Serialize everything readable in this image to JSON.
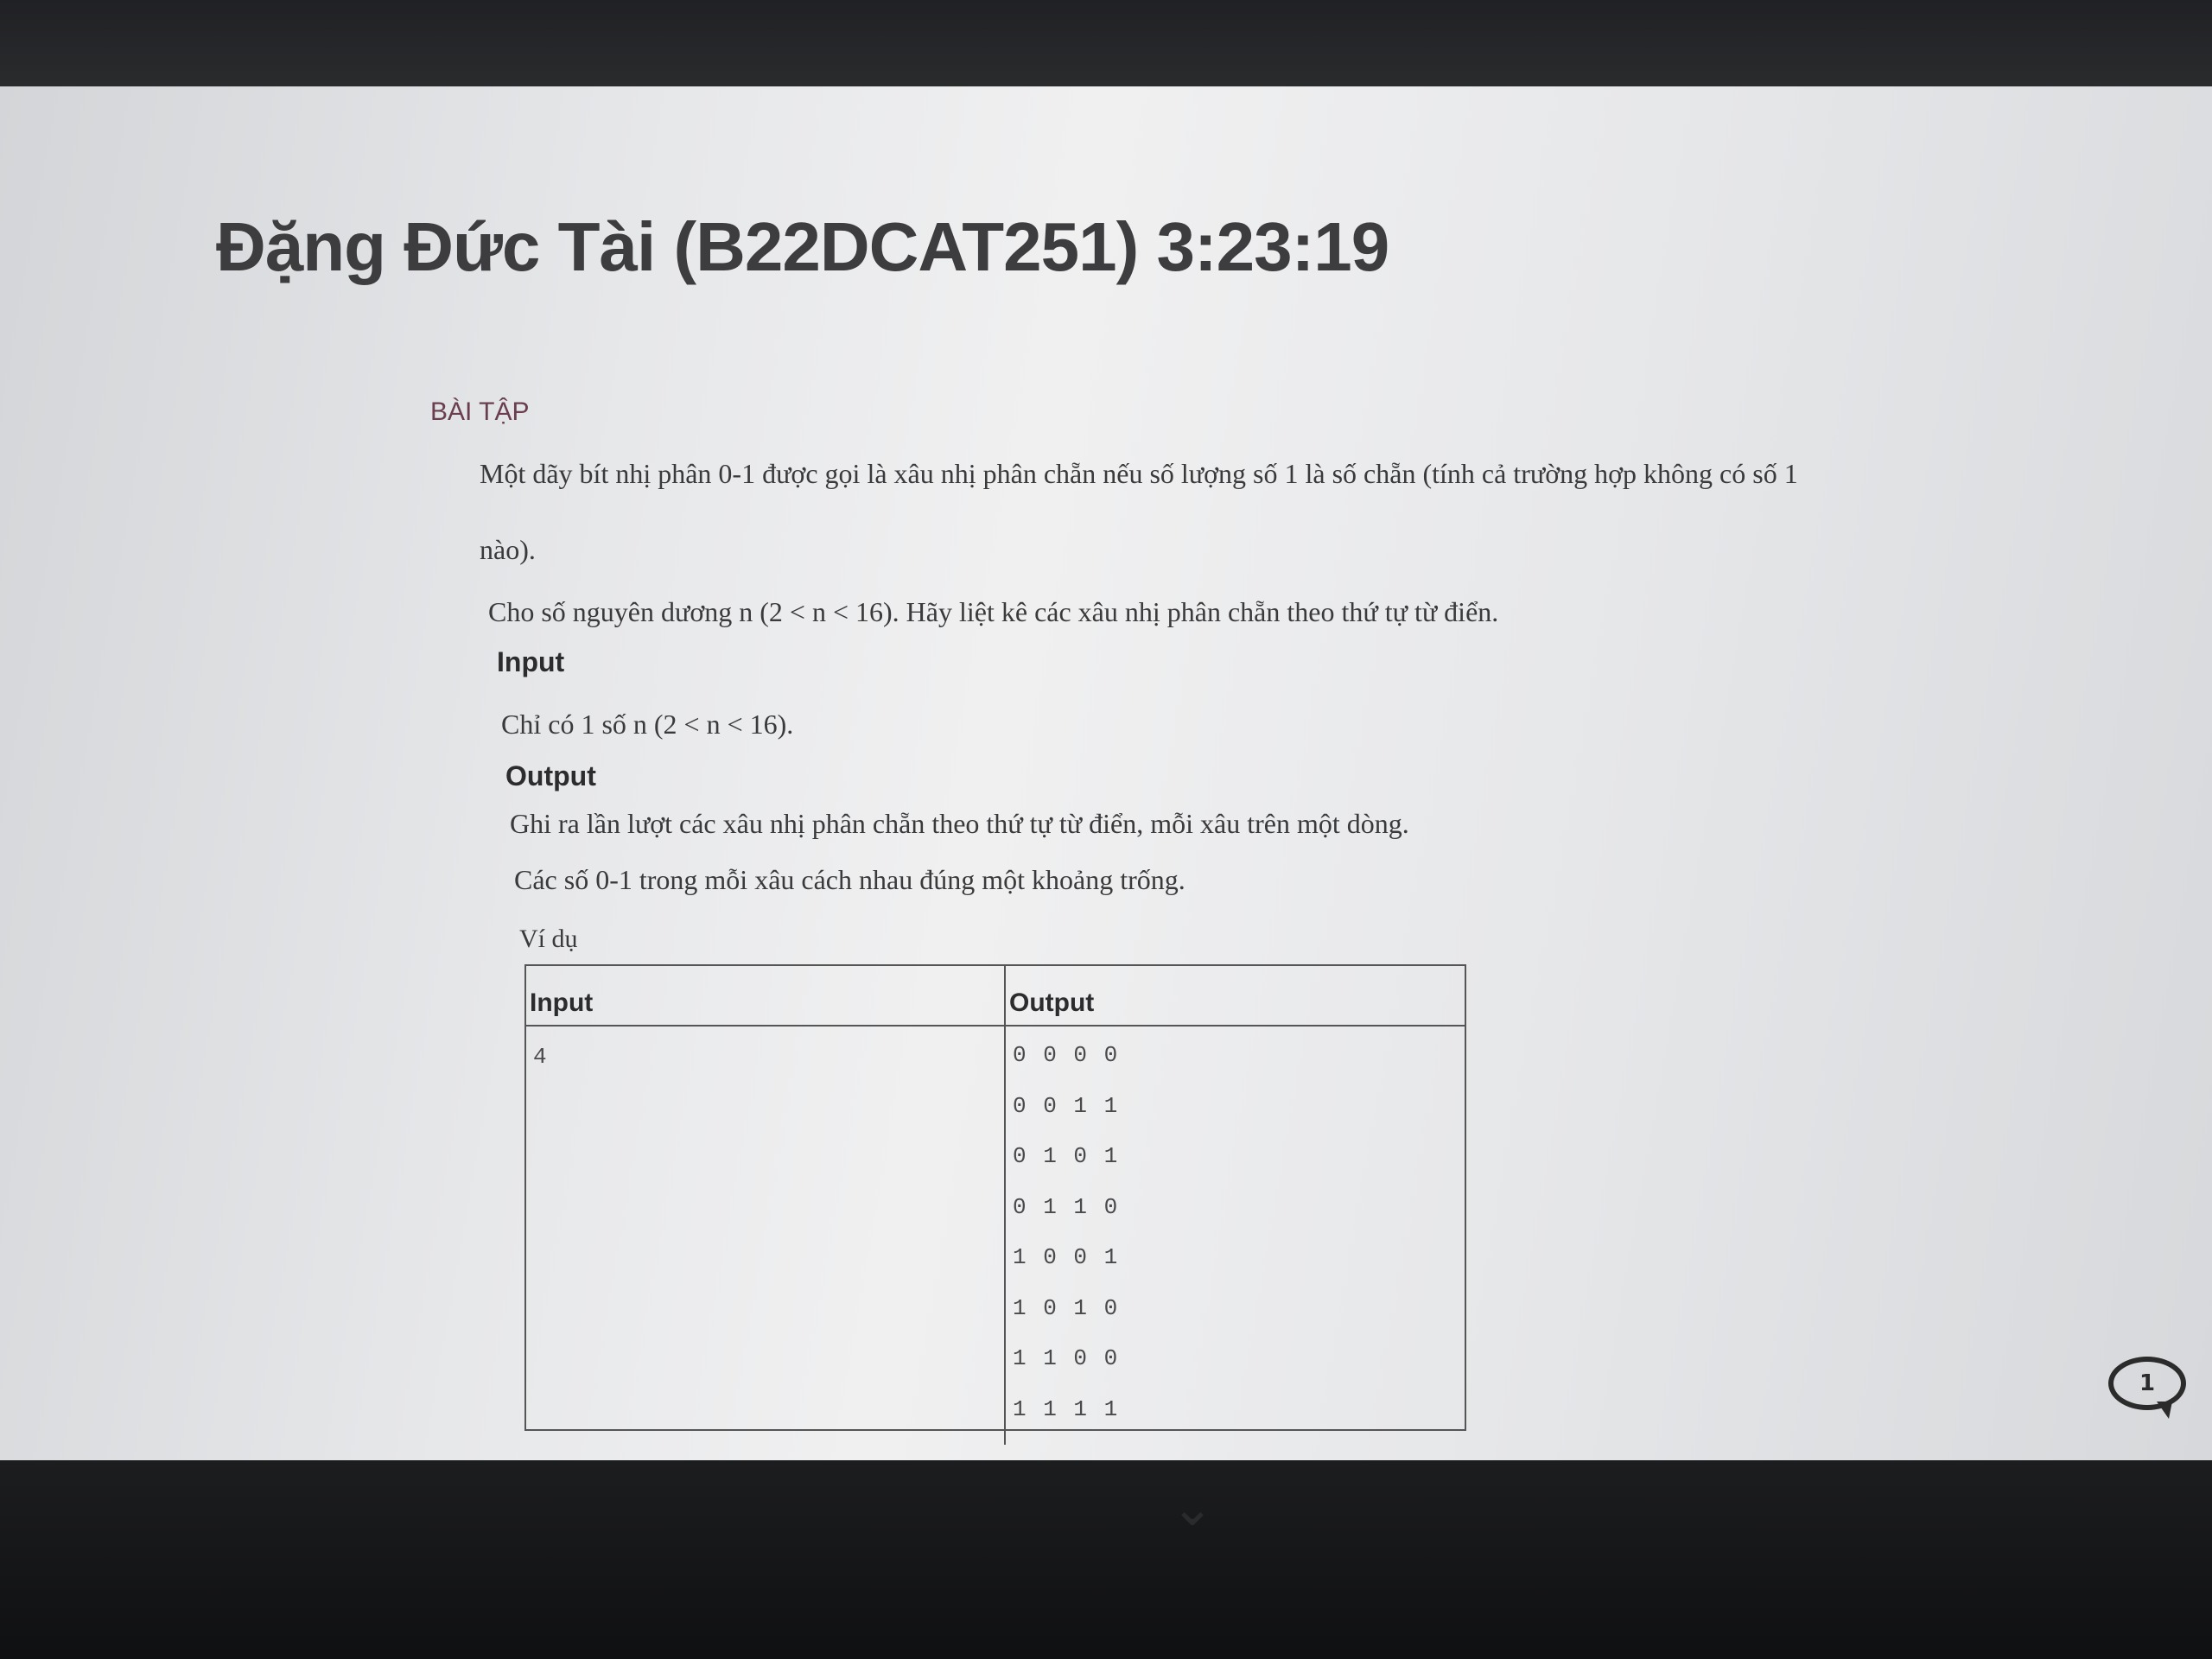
{
  "header": {
    "title": "Đặng Đức Tài (B22DCAT251) 3:23:19"
  },
  "section": {
    "label": "BÀI TẬP"
  },
  "problem": {
    "line1": "Một dãy bít nhị phân 0-1 được gọi là xâu nhị phân chẵn nếu số lượng số 1 là số chẵn (tính cả trường hợp không có số 1",
    "line2": "nào).",
    "line3": "Cho số nguyên dương n (2 < n < 16). Hãy liệt kê các xâu nhị phân chẵn theo thứ tự từ điển.",
    "input_heading": "Input",
    "input_text": "Chỉ có 1 số n (2 < n < 16).",
    "output_heading": "Output",
    "output_text1": "Ghi ra lần lượt các xâu nhị phân chẵn theo thứ tự từ điển, mỗi xâu trên một dòng.",
    "output_text2": "Các số 0-1 trong mỗi xâu cách nhau đúng một khoảng trống."
  },
  "example": {
    "label": "Ví dụ",
    "col_input": "Input",
    "col_output": "Output",
    "input_value": "4",
    "output_lines": [
      "0 0 0 0",
      "0 0 1 1",
      "0 1 0 1",
      "0 1 1 0",
      "1 0 0 1",
      "1 0 1 0",
      "1 1 0 0",
      "1 1 1 1"
    ]
  },
  "chat": {
    "badge": "1"
  }
}
